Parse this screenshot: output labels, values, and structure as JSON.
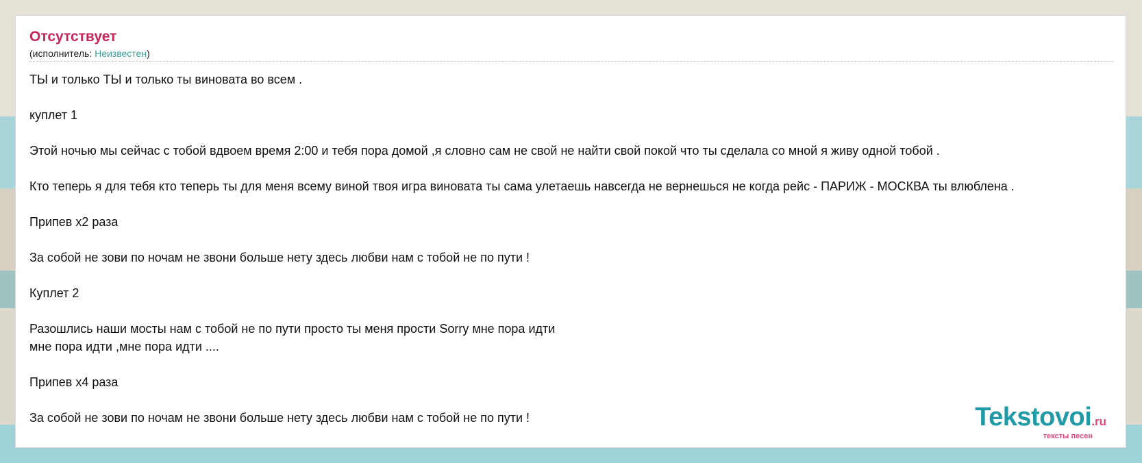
{
  "song": {
    "title": "Отсутствует",
    "performer_prefix": "(исполнитель: ",
    "performer_name": "Неизвестен",
    "performer_suffix": ")"
  },
  "lyrics": [
    "ТЫ и только ТЫ и только ты виновата во всем .",
    "",
    "куплет 1",
    "",
    "Этой ночью мы сейчас с тобой вдвоем время 2:00 и тебя пора домой ,я словно сам не свой не найти свой покой что ты сделала со мной я живу одной тобой .",
    "",
    "Кто теперь я для тебя кто теперь ты для меня всему виной твоя игра виновата ты сама улетаешь навсегда не вернешься не когда рейс - ПАРИЖ - МОСКВА ты влюблена .",
    "",
    "Припев х2 раза",
    "",
    "За собой не зови по ночам не звони больше нету здесь любви нам с тобой не по пути !",
    "",
    "Куплет 2",
    "",
    "Разошлись наши мосты нам с тобой не по пути просто ты меня прости Sorry мне пора идти",
    "мне пора идти ,мне пора идти ....",
    "",
    "Припев х4 раза",
    "",
    "За собой не зови по ночам не звони больше нету здесь любви нам с тобой не по пути !"
  ],
  "logo": {
    "main": "Tekstovoi",
    "tld": ".ru",
    "tagline": "тексты песен"
  }
}
